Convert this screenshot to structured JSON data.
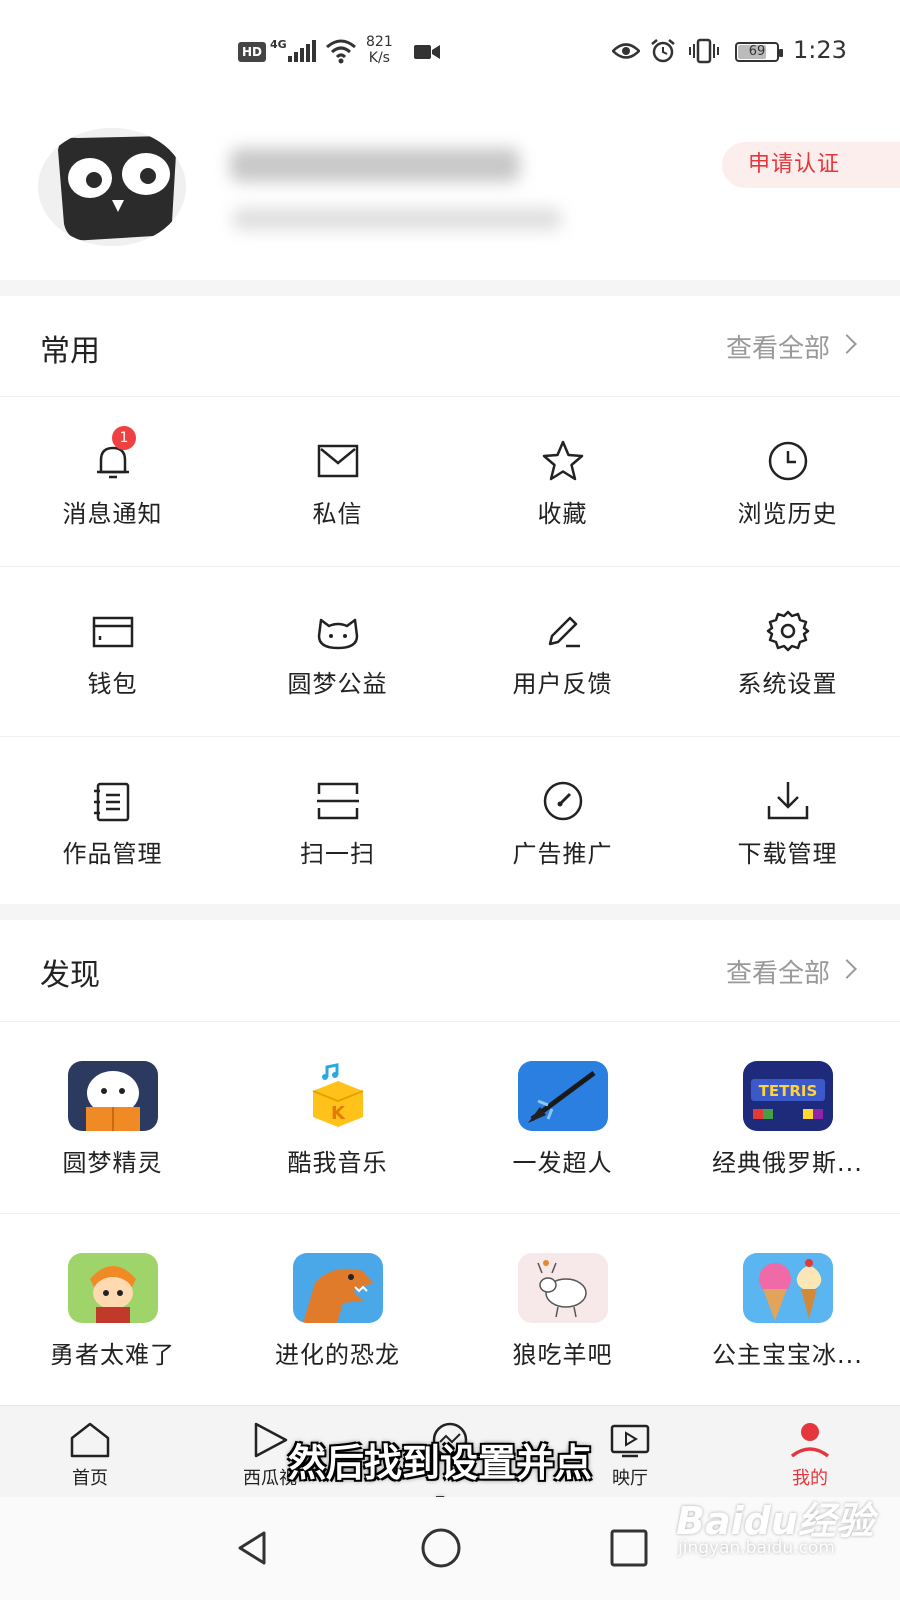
{
  "status_bar": {
    "hd": "HD",
    "network": "4G",
    "speed_value": "821",
    "speed_unit": "K/s",
    "battery": "69",
    "time": "1:23",
    "icons": [
      "hd-icon",
      "signal-icon",
      "wifi-icon",
      "video-icon",
      "eye-icon",
      "alarm-icon",
      "vibrate-icon",
      "battery-icon"
    ]
  },
  "profile": {
    "certify_button": "申请认证"
  },
  "common": {
    "title": "常用",
    "view_all": "查看全部",
    "items": [
      {
        "label": "消息通知",
        "icon": "bell-icon",
        "badge": "1"
      },
      {
        "label": "私信",
        "icon": "mail-icon"
      },
      {
        "label": "收藏",
        "icon": "star-icon"
      },
      {
        "label": "浏览历史",
        "icon": "clock-icon"
      },
      {
        "label": "钱包",
        "icon": "wallet-icon"
      },
      {
        "label": "圆梦公益",
        "icon": "cat-face-icon"
      },
      {
        "label": "用户反馈",
        "icon": "pen-icon"
      },
      {
        "label": "系统设置",
        "icon": "gear-icon"
      },
      {
        "label": "作品管理",
        "icon": "notebook-icon"
      },
      {
        "label": "扫一扫",
        "icon": "scan-icon"
      },
      {
        "label": "广告推广",
        "icon": "gauge-icon"
      },
      {
        "label": "下载管理",
        "icon": "download-icon"
      }
    ]
  },
  "discover": {
    "title": "发现",
    "view_all": "查看全部",
    "apps": [
      {
        "label": "圆梦精灵",
        "icon": "yuanmeng-app-icon"
      },
      {
        "label": "酷我音乐",
        "icon": "kuwo-music-app-icon"
      },
      {
        "label": "一发超人",
        "icon": "arrow-game-app-icon"
      },
      {
        "label": "经典俄罗斯...",
        "icon": "tetris-app-icon",
        "logo_text": "TETRIS"
      },
      {
        "label": "勇者太难了",
        "icon": "hero-game-app-icon"
      },
      {
        "label": "进化的恐龙",
        "icon": "dinosaur-game-app-icon"
      },
      {
        "label": "狼吃羊吧",
        "icon": "sheep-game-app-icon"
      },
      {
        "label": "公主宝宝冰...",
        "icon": "icecream-game-app-icon"
      }
    ]
  },
  "tab_bar": {
    "tabs": [
      {
        "label": "首页",
        "icon": "home-icon"
      },
      {
        "label": "西瓜视",
        "icon": "play-icon"
      },
      {
        "label": "",
        "icon": "chat-icon"
      },
      {
        "label": "映厅",
        "icon": "tv-icon"
      },
      {
        "label": "我的",
        "icon": "user-icon",
        "active": true
      }
    ]
  },
  "overlay": {
    "subtitle": "然后找到设置并点击",
    "watermark_main": "Baidu经验",
    "watermark_sub": "jingyan.baidu.com"
  },
  "colors": {
    "accent": "#e5363d",
    "badge": "#f04142",
    "muted": "#999999"
  }
}
